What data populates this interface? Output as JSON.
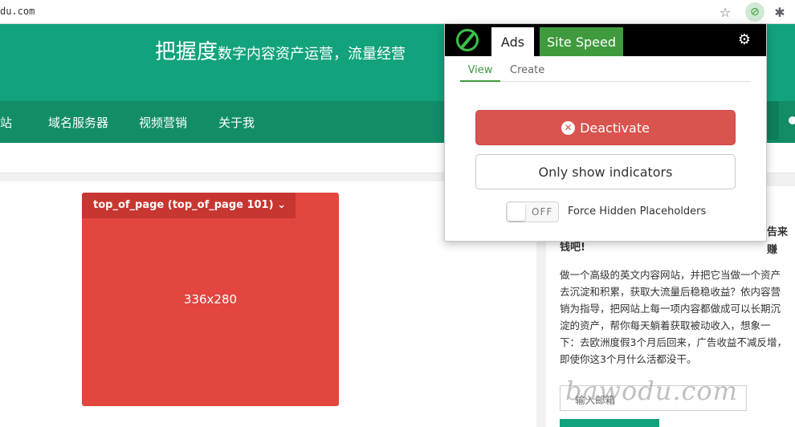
{
  "browser": {
    "url": "du.com",
    "star_icon": "☆",
    "extension_icon": "⊘",
    "puzzle_icon": "✱"
  },
  "site": {
    "title_big": "把握度",
    "title_small": "数字内容资产运营，流量经营",
    "nav": [
      "站",
      "域名服务器",
      "视频营销",
      "关于我"
    ]
  },
  "ad": {
    "tag": "top_of_page (top_of_page 101)",
    "tag_caret": "⌄",
    "size": "336x280"
  },
  "sidebar": {
    "heading_right": "告来赚",
    "heading_left": "钱吧!",
    "lines": [
      "做一个高级的英文内容网站，并把它当做一个资产",
      "去沉淀和积累，获取大流量后稳稳收益？依内容营",
      "销为指导，把网站上每一项内容都做成可以长期沉",
      "淀的资产，帮你每天躺着获取被动收入，想象一",
      "下：去欧洲度假3个月后回来，广告收益不减反增，",
      "即使你这3个月什么活都没干。"
    ],
    "email_placeholder": "输入邮箱",
    "watermark": "bawodu.com"
  },
  "popup": {
    "tab_ads": "Ads",
    "tab_speed": "Site Speed",
    "gear_icon": "⚙",
    "sub_view": "View",
    "sub_create": "Create",
    "deactivate_icon": "✕",
    "deactivate_label": "Deactivate",
    "indicators_label": "Only show indicators",
    "toggle_state": "OFF",
    "toggle_label": "Force Hidden Placeholders"
  },
  "colors": {
    "brand_green": "#12a37c",
    "nav_green": "#128d68",
    "ad_red": "#e2463f",
    "deactivate_red": "#d9534f",
    "speed_tab_green": "#3f9a3e"
  }
}
